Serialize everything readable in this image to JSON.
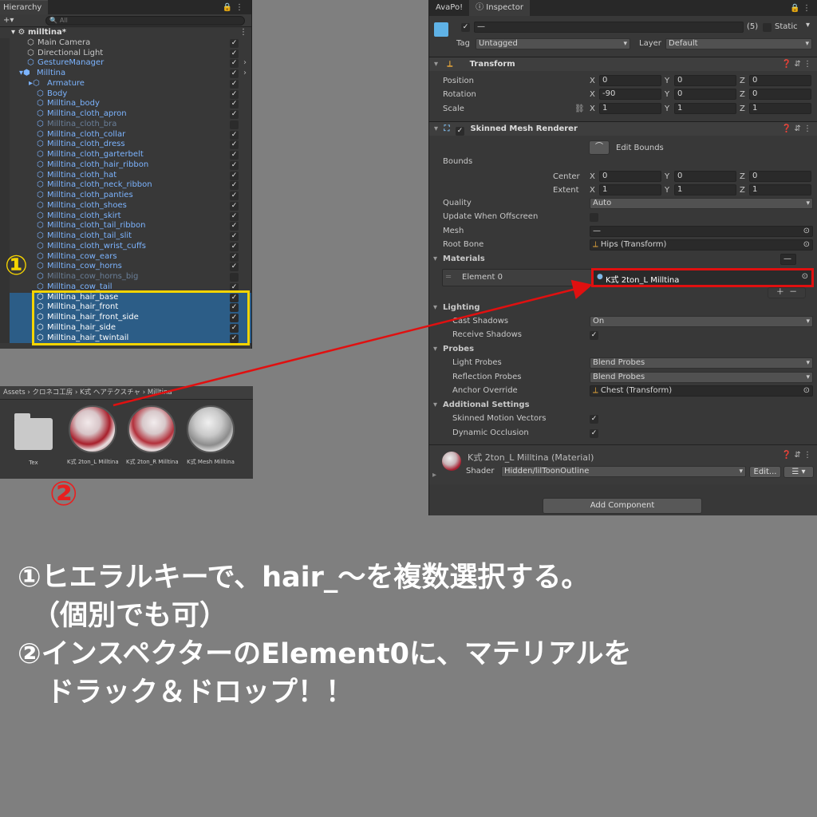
{
  "hierarchy": {
    "tab": "Hierarchy",
    "search_placeholder": "All",
    "scene": "milltina*",
    "rows": [
      {
        "label": "Main Camera",
        "indent": 2,
        "style": "normal",
        "checked": true
      },
      {
        "label": "Directional Light",
        "indent": 2,
        "style": "normal",
        "checked": true
      },
      {
        "label": "GestureManager",
        "indent": 2,
        "style": "blue",
        "checked": true
      },
      {
        "label": "Milltina",
        "indent": 1,
        "style": "blue",
        "checked": true
      },
      {
        "label": "Armature",
        "indent": 3,
        "style": "blue",
        "checked": true
      },
      {
        "label": "Body",
        "indent": 3,
        "style": "blue",
        "checked": true
      },
      {
        "label": "Milltina_body",
        "indent": 3,
        "style": "blue",
        "checked": true
      },
      {
        "label": "Milltina_cloth_apron",
        "indent": 3,
        "style": "blue",
        "checked": true
      },
      {
        "label": "Milltina_cloth_bra",
        "indent": 3,
        "style": "dim",
        "checked": false
      },
      {
        "label": "Milltina_cloth_collar",
        "indent": 3,
        "style": "blue",
        "checked": true
      },
      {
        "label": "Milltina_cloth_dress",
        "indent": 3,
        "style": "blue",
        "checked": true
      },
      {
        "label": "Milltina_cloth_garterbelt",
        "indent": 3,
        "style": "blue",
        "checked": true
      },
      {
        "label": "Milltina_cloth_hair_ribbon",
        "indent": 3,
        "style": "blue",
        "checked": true
      },
      {
        "label": "Milltina_cloth_hat",
        "indent": 3,
        "style": "blue",
        "checked": true
      },
      {
        "label": "Milltina_cloth_neck_ribbon",
        "indent": 3,
        "style": "blue",
        "checked": true
      },
      {
        "label": "Milltina_cloth_panties",
        "indent": 3,
        "style": "blue",
        "checked": true
      },
      {
        "label": "Milltina_cloth_shoes",
        "indent": 3,
        "style": "blue",
        "checked": true
      },
      {
        "label": "Milltina_cloth_skirt",
        "indent": 3,
        "style": "blue",
        "checked": true
      },
      {
        "label": "Milltina_cloth_tail_ribbon",
        "indent": 3,
        "style": "blue",
        "checked": true
      },
      {
        "label": "Milltina_cloth_tail_slit",
        "indent": 3,
        "style": "blue",
        "checked": true
      },
      {
        "label": "Milltina_cloth_wrist_cuffs",
        "indent": 3,
        "style": "blue",
        "checked": true
      },
      {
        "label": "Milltina_cow_ears",
        "indent": 3,
        "style": "blue",
        "checked": true
      },
      {
        "label": "Milltina_cow_horns",
        "indent": 3,
        "style": "blue",
        "checked": true
      },
      {
        "label": "Milltina_cow_horns_big",
        "indent": 3,
        "style": "dim",
        "checked": false
      },
      {
        "label": "Milltina_cow_tail",
        "indent": 3,
        "style": "blue",
        "checked": true
      },
      {
        "label": "Milltina_hair_base",
        "indent": 3,
        "style": "sel",
        "checked": true
      },
      {
        "label": "Milltina_hair_front",
        "indent": 3,
        "style": "sel",
        "checked": true
      },
      {
        "label": "Milltina_hair_front_side",
        "indent": 3,
        "style": "sel",
        "checked": true
      },
      {
        "label": "Milltina_hair_side",
        "indent": 3,
        "style": "sel",
        "checked": true
      },
      {
        "label": "Milltina_hair_twintail",
        "indent": 3,
        "style": "sel",
        "checked": true
      }
    ]
  },
  "assets": {
    "path": "Assets › クロネコ工房 › K式 ヘアテクスチャ › Milltina",
    "items": [
      {
        "label": "Tex",
        "kind": "folder"
      },
      {
        "label": "K式 2ton_L Milltina",
        "kind": "material-red"
      },
      {
        "label": "K式 2ton_R Milltina",
        "kind": "material-red"
      },
      {
        "label": "K式 Mesh Milltina",
        "kind": "material-gray"
      }
    ]
  },
  "inspector": {
    "tabs": [
      "AvaPo!",
      "Inspector"
    ],
    "object_name": "—",
    "count": "(5)",
    "static_label": "Static",
    "tag_label": "Tag",
    "tag_value": "Untagged",
    "layer_label": "Layer",
    "layer_value": "Default",
    "transform": {
      "title": "Transform",
      "position_label": "Position",
      "rotation_label": "Rotation",
      "scale_label": "Scale",
      "position": [
        "0",
        "0",
        "0"
      ],
      "rotation": [
        "-90",
        "0",
        "0"
      ],
      "scale": [
        "1",
        "1",
        "1"
      ]
    },
    "smr": {
      "title": "Skinned Mesh Renderer",
      "edit_bounds": "Edit Bounds",
      "bounds_label": "Bounds",
      "center_label": "Center",
      "extent_label": "Extent",
      "center": [
        "0",
        "0",
        "0"
      ],
      "extent": [
        "1",
        "1",
        "1"
      ],
      "quality_label": "Quality",
      "quality_value": "Auto",
      "update_offscreen_label": "Update When Offscreen",
      "mesh_label": "Mesh",
      "mesh_value": "—",
      "root_bone_label": "Root Bone",
      "root_bone_value": "Hips (Transform)",
      "materials_label": "Materials",
      "materials_count": "—",
      "element0_label": "Element 0",
      "element0_value": "K式 2ton_L Milltina",
      "lighting_label": "Lighting",
      "cast_shadows_label": "Cast Shadows",
      "cast_shadows_value": "On",
      "receive_shadows_label": "Receive Shadows",
      "probes_label": "Probes",
      "light_probes_label": "Light Probes",
      "light_probes_value": "Blend Probes",
      "reflection_probes_label": "Reflection Probes",
      "reflection_probes_value": "Blend Probes",
      "anchor_override_label": "Anchor Override",
      "anchor_override_value": "Chest (Transform)",
      "additional_label": "Additional Settings",
      "skinned_motion_label": "Skinned Motion Vectors",
      "dynamic_occlusion_label": "Dynamic Occlusion"
    },
    "material": {
      "title": "K式 2ton_L Milltina (Material)",
      "shader_label": "Shader",
      "shader_value": "Hidden/lilToonOutline",
      "edit_button": "Edit..."
    },
    "add_component": "Add Component"
  },
  "annotations": {
    "mark1": "①",
    "mark2": "②",
    "line1": "①ヒエラルキーで、hair_～を複数選択する。",
    "line2": "（個別でも可）",
    "line3": "②インスペクターのElement0に、マテリアルを",
    "line4": "ドラック＆ドロップ！！"
  },
  "colors": {
    "highlight_yellow": "#f5d400",
    "highlight_red": "#e01010",
    "selection": "#2c5d87",
    "prefab_blue": "#7cb4ff"
  }
}
